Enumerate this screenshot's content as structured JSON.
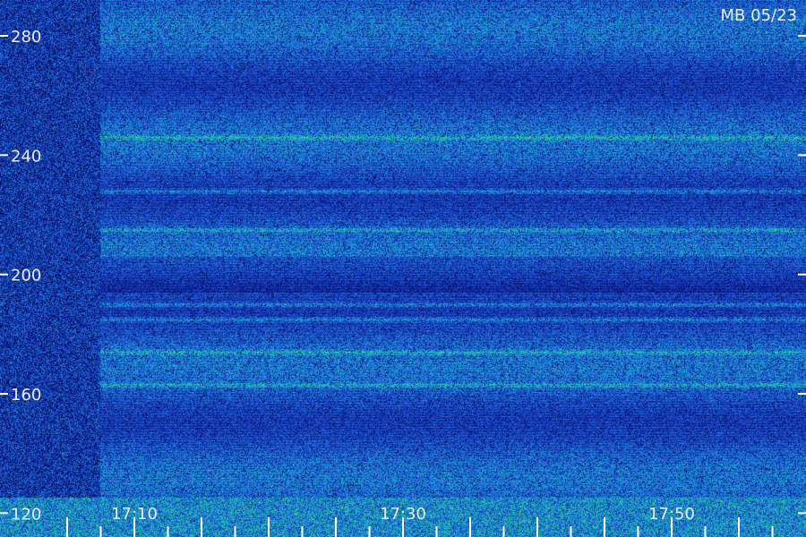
{
  "chart_data": {
    "type": "heatmap",
    "title": "MB 05/23",
    "xlabel": "",
    "ylabel": "",
    "x_tick_labels": [
      "17:10",
      "17:30",
      "17:50"
    ],
    "y_ticks": [
      120,
      160,
      200,
      240,
      280
    ],
    "ylim": [
      112,
      292
    ],
    "grid": false,
    "colormap": [
      "#000020",
      "#0a1a8c",
      "#1f50d0",
      "#1a9ad8",
      "#20c8a0",
      "#50e060"
    ],
    "bright_bands_y": [
      246,
      228,
      215,
      190,
      185,
      174,
      163
    ],
    "quiet_band_y": [
      194,
      206
    ]
  }
}
